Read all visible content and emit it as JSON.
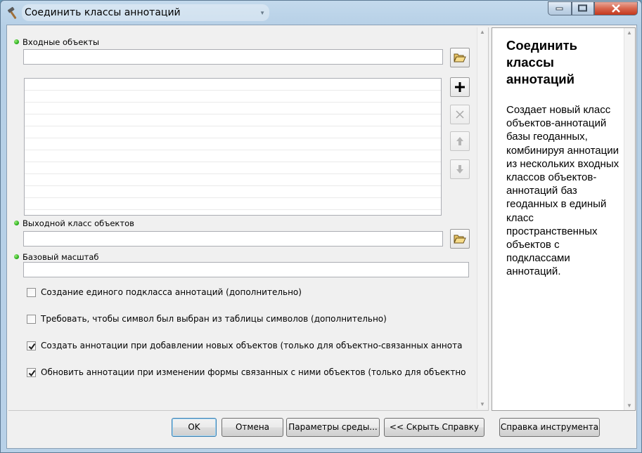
{
  "window": {
    "title": "Соединить классы аннотаций"
  },
  "params": {
    "input_label": "Входные объекты",
    "input_value": "",
    "list_rows": [
      "",
      "",
      "",
      "",
      "",
      "",
      "",
      "",
      "",
      "",
      ""
    ],
    "output_label": "Выходной класс объектов",
    "output_value": "",
    "scale_label": "Базовый масштаб",
    "scale_value": ""
  },
  "checkboxes": [
    {
      "label": "Создание единого подкласса аннотаций (дополнительно)",
      "checked": false
    },
    {
      "label": "Требовать, чтобы символ был выбран из таблицы символов (дополнительно)",
      "checked": false
    },
    {
      "label": "Создать аннотации при добавлении новых объектов (только для объектно-связанных аннота",
      "checked": true
    },
    {
      "label": "Обновить аннотации при изменении формы связанных с ними объектов (только для объектно",
      "checked": true
    }
  ],
  "help": {
    "title": "Соединить классы аннотаций",
    "body": "Создает новый класс объектов-аннотаций базы геоданных, комбинируя аннотации из нескольких входных классов объектов-аннотаций баз геоданных в единый класс пространственных объектов с подклассами аннотаций."
  },
  "buttons": {
    "ok": "OK",
    "cancel": "Отмена",
    "env": "Параметры среды...",
    "hide_help": "<< Скрыть Справку",
    "tool_help": "Справка инструмента"
  },
  "icons": {
    "title": "hammer-icon",
    "browse": "open-folder-icon",
    "add": "plus-icon",
    "remove": "x-icon",
    "up": "arrow-up-icon",
    "down": "arrow-down-icon"
  },
  "colors": {
    "required_dot": "#1fa614",
    "close_button": "#c4381d",
    "default_button_border": "#3c7fb1"
  }
}
